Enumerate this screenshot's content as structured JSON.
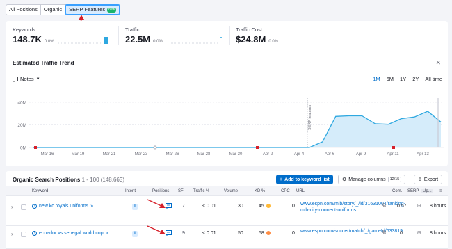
{
  "tabs": [
    {
      "label": "All Positions"
    },
    {
      "label": "Organic"
    },
    {
      "label": "SERP Features",
      "badge": "new"
    }
  ],
  "metrics": [
    {
      "label": "Keywords",
      "value": "148.7K",
      "change": "0.0%"
    },
    {
      "label": "Traffic",
      "value": "22.5M",
      "change": "0.0%"
    },
    {
      "label": "Traffic Cost",
      "value": "$24.8M",
      "change": "0.0%"
    }
  ],
  "trend": {
    "title": "Estimated Traffic Trend",
    "notes_label": "Notes",
    "ranges": [
      "1M",
      "6M",
      "1Y",
      "2Y",
      "All time"
    ],
    "active_range": "1M",
    "serp_annotation": "SERP features"
  },
  "chart_data": {
    "type": "area",
    "y_ticks": [
      "40M",
      "20M",
      "0M"
    ],
    "ylim": [
      0,
      40
    ],
    "x_labels": [
      "Mar 16",
      "Mar 19",
      "Mar 21",
      "Mar 23",
      "Mar 26",
      "Mar 28",
      "Mar 30",
      "Apr 2",
      "Apr 4",
      "Apr 6",
      "Apr 9",
      "Apr 11",
      "Apr 13"
    ],
    "series": [
      {
        "values": [
          0,
          0,
          0,
          0,
          0,
          0,
          0,
          0,
          0,
          0,
          0,
          0,
          0,
          0,
          0,
          0,
          0,
          0,
          0,
          0,
          0,
          0,
          5,
          27.5,
          28,
          28,
          21,
          20.5,
          25.5,
          27,
          32,
          22.5
        ]
      }
    ],
    "accent": "#2ea8e0",
    "fill": "#d5ecfa"
  },
  "positions": {
    "title": "Organic Search Positions",
    "range_text": "1 - 100 (148,663)",
    "add_label": "Add to keyword list",
    "manage_label": "Manage columns",
    "manage_count": "12/15",
    "export_label": "Export",
    "columns": [
      "Keyword",
      "Intent",
      "Positions",
      "SF",
      "Traffic %",
      "Volume",
      "KD %",
      "CPC",
      "URL",
      "Com.",
      "SERP",
      "Up..."
    ],
    "rows": [
      {
        "keyword": "new kc royals uniforms",
        "intent": "I",
        "sf": "7",
        "traffic": "< 0.01",
        "volume": "30",
        "kd": "45",
        "kd_color": "#ffb936",
        "cpc": "0",
        "url": "www.espn.com/mlb/story/_/id/31631004/ranking-mlb-city-connect-uniforms",
        "com": "0.57",
        "updated": "8 hours"
      },
      {
        "keyword": "ecuador vs senegal world cup",
        "intent": "I",
        "sf": "9",
        "traffic": "< 0.01",
        "volume": "50",
        "kd": "58",
        "kd_color": "#ff8c43",
        "cpc": "0",
        "url": "www.espn.com/soccer/match/_/gameId/633819",
        "com": "0",
        "updated": "8 hours"
      }
    ]
  }
}
